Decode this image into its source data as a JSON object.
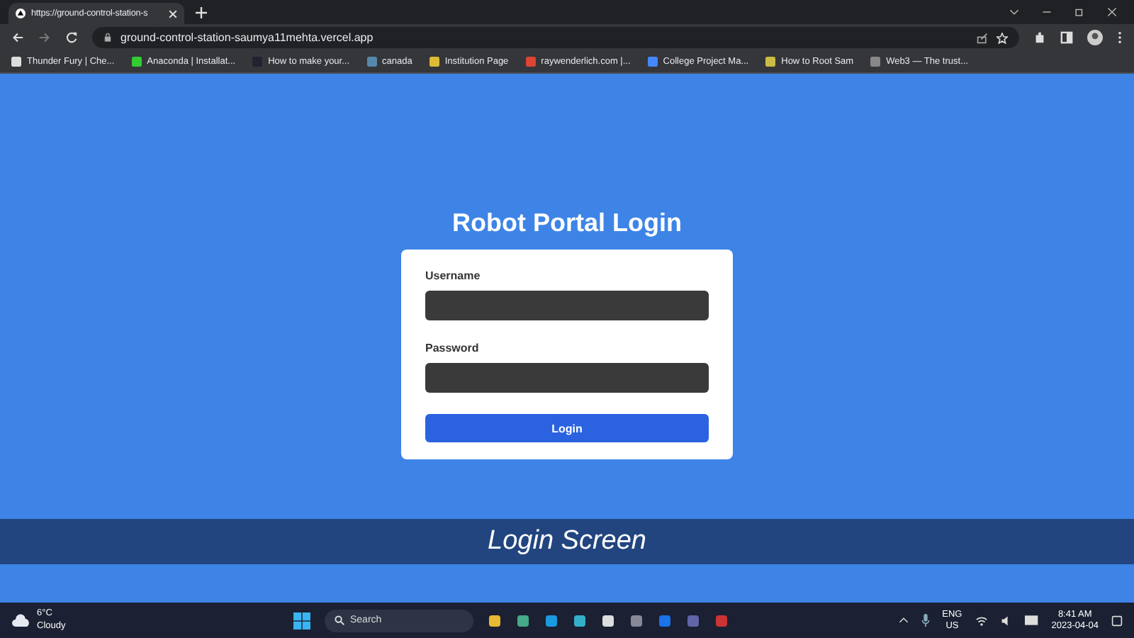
{
  "browser": {
    "tab_title": "https://ground-control-station-s",
    "address": "ground-control-station-saumya11mehta.vercel.app",
    "bookmarks": [
      {
        "label": "Thunder Fury | Che..."
      },
      {
        "label": "Anaconda | Installat..."
      },
      {
        "label": "How to make your..."
      },
      {
        "label": "canada"
      },
      {
        "label": "Institution Page"
      },
      {
        "label": "raywenderlich.com |..."
      },
      {
        "label": "College Project Ma..."
      },
      {
        "label": "How to Root Sam"
      },
      {
        "label": "Web3 — The trust..."
      }
    ]
  },
  "page": {
    "heading": "Robot Portal Login",
    "fields": [
      {
        "label": "Username"
      },
      {
        "label": "Password"
      }
    ],
    "button": "Login"
  },
  "caption": "Login Screen",
  "taskbar": {
    "temperature": "6°C",
    "condition": "Cloudy",
    "search_placeholder": "Search",
    "language": "ENG",
    "region": "US",
    "time": "8:41 AM",
    "date": "2023-04-04"
  }
}
